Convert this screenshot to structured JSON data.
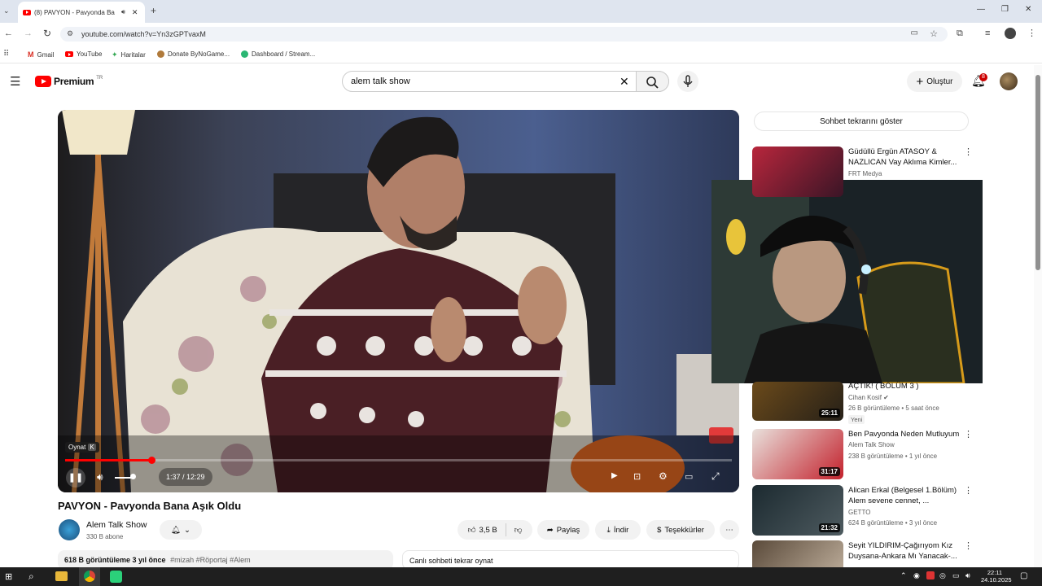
{
  "browser": {
    "tab_title": "(8) PAVYON - Pavyonda Ba",
    "url": "youtube.com/watch?v=Yn3zGPTvaxM",
    "bookmarks": [
      "Gmail",
      "YouTube",
      "Haritalar",
      "Donate ByNoGame...",
      "Dashboard / Stream..."
    ]
  },
  "youtube": {
    "logo_text": "Premium",
    "logo_region": "TR",
    "search_value": "alem talk show",
    "create_label": "Oluştur",
    "notification_count": "8"
  },
  "player": {
    "tooltip": "Oynat",
    "tooltip_key": "K",
    "time": "1:37 / 12:29",
    "progress_fraction": 0.13
  },
  "video": {
    "title": "PAVYON - Pavyonda Bana Aşık Oldu",
    "channel": "Alem Talk Show",
    "subscribers": "330 B abone",
    "likes": "3,5 B",
    "share": "Paylaş",
    "download": "İndir",
    "thanks": "Teşekkürler",
    "description_stats": "618 B görüntüleme  3 yıl önce",
    "description_tags": "#mizah #Röportaj #Alem",
    "live_chat_replay": "Canlı sohbeti tekrar oynat"
  },
  "sidebar": {
    "chat_replay_button": "Sohbet tekrarını göster",
    "recommendations": [
      {
        "title": "Güdüllü Ergün ATASOY & NAZLICAN  Vay Aklıma Kimler...",
        "channel": "FRT Medya",
        "meta": "",
        "duration": ""
      },
      {
        "title": "AÇTIK! ( BÖLÜM 3 )",
        "channel": "Cihan Kosif",
        "meta": "26 B görüntüleme • 5 saat önce",
        "badge": "Yeni",
        "duration": "25:11"
      },
      {
        "title": "Ben Pavyonda Neden Mutluyum",
        "channel": "Alem Talk Show",
        "meta": "238 B görüntüleme • 1 yıl önce",
        "duration": "31:17"
      },
      {
        "title": "Alican Erkal (Belgesel 1.Bölüm) Alem sevene cennet, ...",
        "channel": "GETTO",
        "meta": "624 B görüntüleme • 3 yıl önce",
        "duration": "21:32"
      },
      {
        "title": "Seyit YILDIRIM-Çağırıyom Kız Duysana-Ankara Mı Yanacak-...",
        "channel": "",
        "meta": "",
        "duration": ""
      }
    ]
  },
  "taskbar": {
    "time": "22:11",
    "date": "24.10.2025"
  }
}
